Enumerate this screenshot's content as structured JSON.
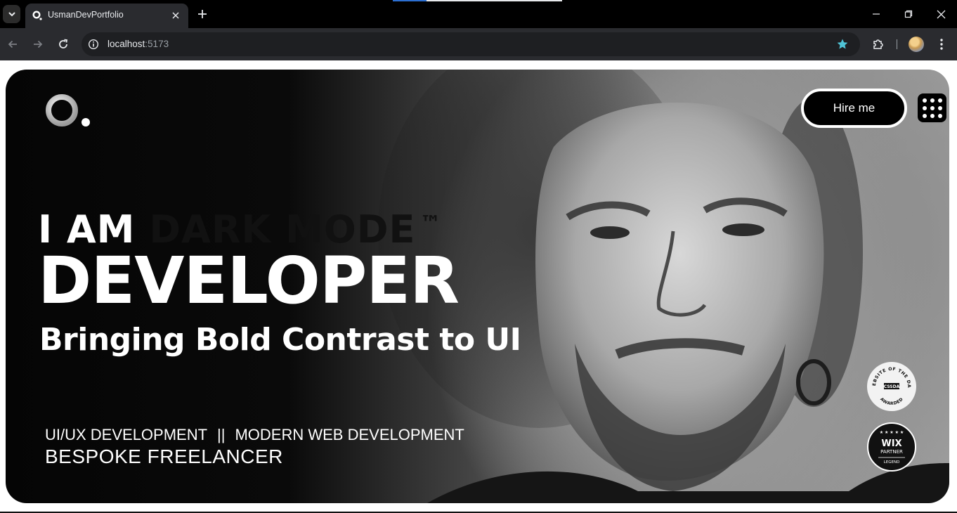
{
  "browser": {
    "tab_title": "UsmanDevPortfolio",
    "url_host": "localhost",
    "url_port": ":5173",
    "icons": {
      "tab_list": "chevron-down-icon",
      "tab_close": "close-icon",
      "new_tab": "plus-icon",
      "minimize": "minimize-icon",
      "restore": "restore-icon",
      "close_window": "close-icon",
      "back": "arrow-left-icon",
      "forward": "arrow-right-icon",
      "reload": "reload-icon",
      "site_info": "info-icon",
      "bookmark": "star-icon",
      "extensions": "puzzle-icon",
      "profile": "avatar",
      "menu": "kebab-icon"
    },
    "bookmark_color": "#4fc3d6"
  },
  "page": {
    "header": {
      "hire_label": "Hire me",
      "menu_icon": "grid-dots-icon"
    },
    "hero": {
      "line1_prefix": "I AM ",
      "line1_dark": "DARK MODE",
      "line1_tm": "™",
      "line2": "DEVELOPER",
      "line3": "Bringing Bold Contrast to UI",
      "service1": "UI/UX DEVELOPMENT",
      "divider": "||",
      "service2": "MODERN WEB DEVELOPMENT",
      "role": "BESPOKE FREELANCER"
    },
    "badges": {
      "css": {
        "top_text": "WEBSITE OF THE DAY",
        "center_text": "CSSDA",
        "bottom_text": "AWARDED"
      },
      "wix": {
        "title": "WIX",
        "subtitle": "PARTNER",
        "footer": "LEGEND"
      }
    }
  }
}
